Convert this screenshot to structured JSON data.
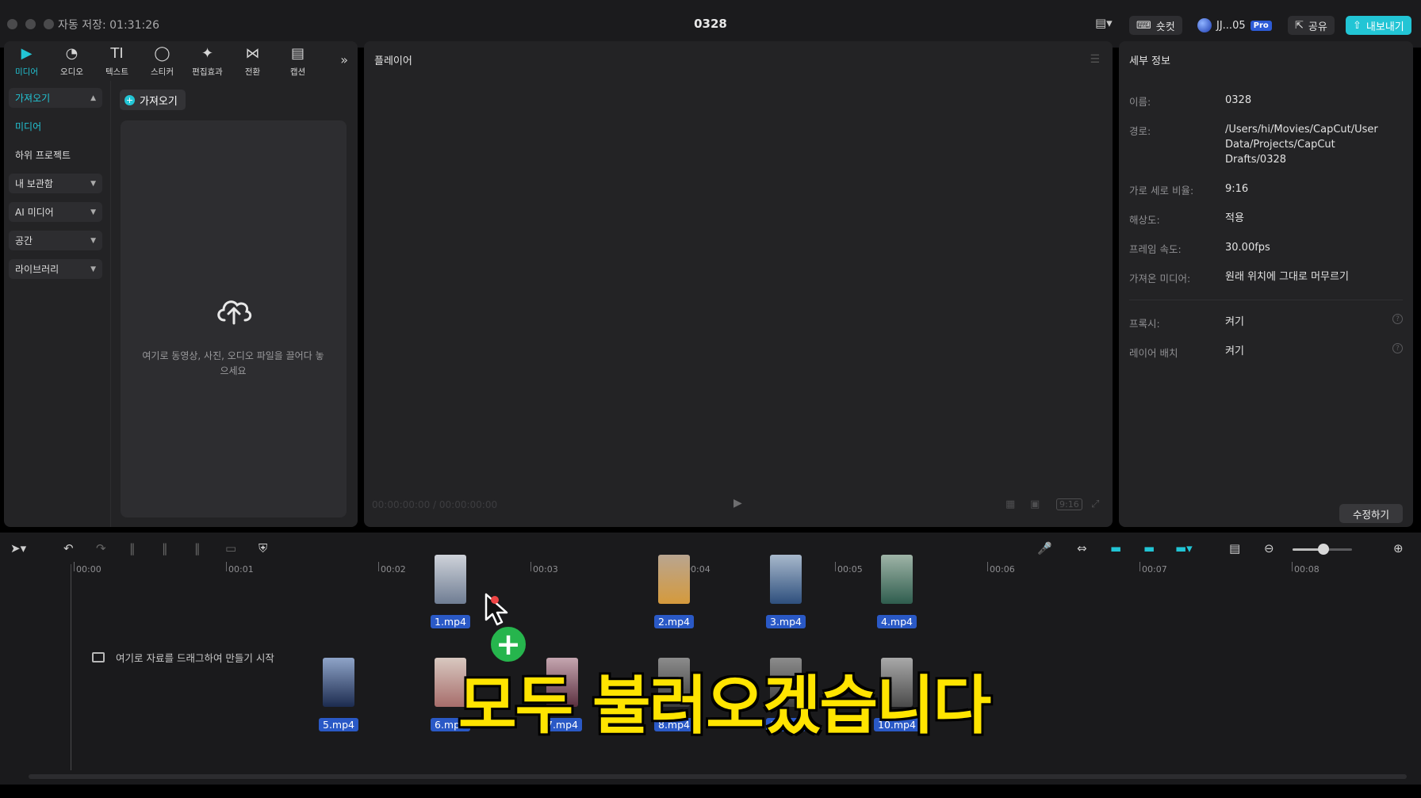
{
  "window": {
    "autosave": "자동 저장: 01:31:26",
    "title": "0328",
    "shortcut_label": "숏컷",
    "user_label": "JJ...05",
    "pro_badge": "Pro",
    "share_label": "공유",
    "export_label": "내보내기"
  },
  "toolbar": {
    "tools": [
      {
        "label": "미디어",
        "icon": "media-icon"
      },
      {
        "label": "오디오",
        "icon": "audio-icon"
      },
      {
        "label": "텍스트",
        "icon": "text-icon"
      },
      {
        "label": "스티커",
        "icon": "sticker-icon"
      },
      {
        "label": "편집효과",
        "icon": "effects-icon"
      },
      {
        "label": "전환",
        "icon": "transition-icon"
      },
      {
        "label": "캡션",
        "icon": "caption-icon"
      }
    ]
  },
  "sidebar": {
    "items": [
      {
        "label": "가져오기"
      },
      {
        "label": "미디어"
      },
      {
        "label": "하위 프로젝트"
      },
      {
        "label": "내 보관함"
      },
      {
        "label": "AI 미디어"
      },
      {
        "label": "공간"
      },
      {
        "label": "라이브러리"
      }
    ]
  },
  "import": {
    "chip_label": "가져오기",
    "drop_text": "여기로 동영상, 사진, 오디오 파일을 끌어다 놓으세요"
  },
  "player": {
    "title": "플레이어",
    "timecode": "00:00:00:00 / 00:00:00:00",
    "ratio_label": "9:16"
  },
  "details": {
    "title": "세부 정보",
    "rows": [
      {
        "label": "이름:",
        "value": "0328"
      },
      {
        "label": "경로:",
        "value": "/Users/hi/Movies/CapCut/User Data/Projects/CapCut Drafts/0328"
      },
      {
        "label": "가로 세로 비율:",
        "value": "9:16"
      },
      {
        "label": "해상도:",
        "value": "적용"
      },
      {
        "label": "프레임 속도:",
        "value": "30.00fps"
      },
      {
        "label": "가져온 미디어:",
        "value": "원래 위치에 그대로 머무르기"
      },
      {
        "label": "프록시:",
        "value": "켜기"
      },
      {
        "label": "레이어 배치",
        "value": "켜기"
      }
    ],
    "edit_label": "수정하기"
  },
  "timeline": {
    "ticks": [
      "00:00",
      "00:01",
      "00:02",
      "00:03",
      "00:04",
      "00:05",
      "00:06",
      "00:07",
      "00:08"
    ],
    "drop_hint": "여기로 자료를 드래그하여 만들기 시작",
    "clips": [
      {
        "name": "1.mp4",
        "color_top": "#cfd3da",
        "color_bottom": "#6f7d93"
      },
      {
        "name": "2.mp4",
        "color_top": "#b9a590",
        "color_bottom": "#d59a3c"
      },
      {
        "name": "3.mp4",
        "color_top": "#a8b9cc",
        "color_bottom": "#2e4f7d"
      },
      {
        "name": "4.mp4",
        "color_top": "#9fb4a7",
        "color_bottom": "#2f5d4e"
      },
      {
        "name": "5.mp4",
        "color_top": "#8fa4c8",
        "color_bottom": "#1c2b4f"
      },
      {
        "name": "6.mp4",
        "color_top": "#d8c8c0",
        "color_bottom": "#a76d6b"
      },
      {
        "name": "7.mp4",
        "color_top": "#c5a6b0",
        "color_bottom": "#5c3040"
      },
      {
        "name": "8.mp4",
        "color_top": "#8c8c8c",
        "color_bottom": "#3c3c3c"
      },
      {
        "name": "9.mp4",
        "color_top": "#8c8c8c",
        "color_bottom": "#3c3c3c"
      },
      {
        "name": "10.mp4",
        "color_top": "#a9a9a9",
        "color_bottom": "#4a4a4a"
      }
    ]
  },
  "overlay": {
    "caption": "모두 불러오겠습니다"
  },
  "colors": {
    "accent": "#22c5d5",
    "clip_label": "#2a59c6",
    "caption": "#ffe400",
    "add_badge": "#26b54d"
  }
}
